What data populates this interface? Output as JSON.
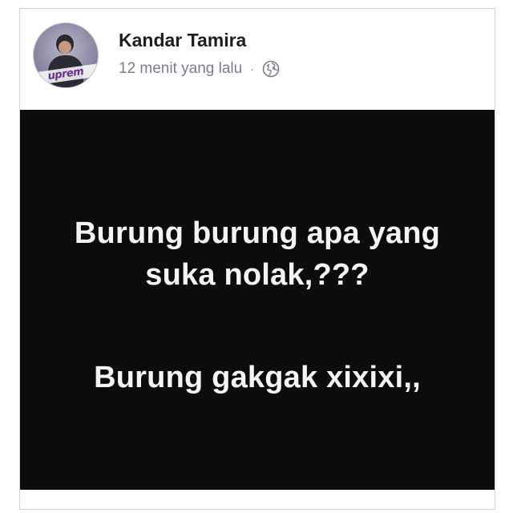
{
  "post": {
    "author": "Kandar Tamira",
    "timestamp": "12 menit yang lalu",
    "separator": "·",
    "privacy_icon": "globe-icon",
    "avatar_text": "uprem",
    "body_lines": [
      "Burung burung apa yang",
      "suka nolak,???",
      "Burung gakgak xixixi,,"
    ],
    "background_color": "#0c0c0c",
    "text_color": "#f4f4f4"
  }
}
